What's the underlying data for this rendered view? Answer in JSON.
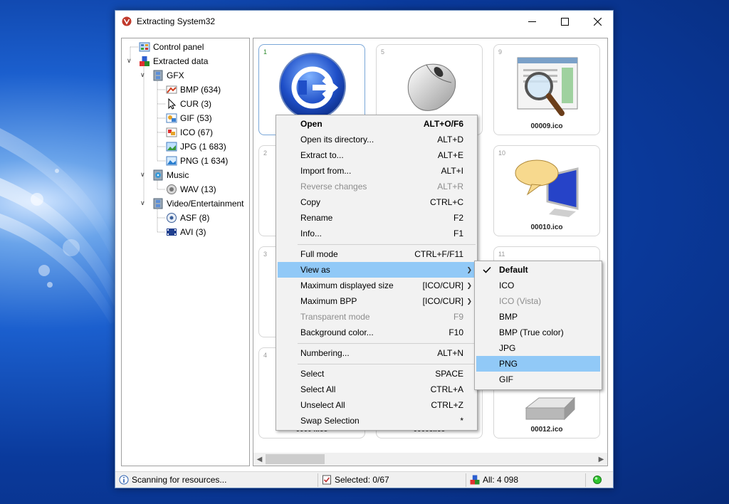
{
  "window": {
    "title": "Extracting System32"
  },
  "tree": [
    {
      "label": "Control panel",
      "icon": "control-panel-icon"
    },
    {
      "label": "Extracted data",
      "icon": "extracted-data-icon"
    },
    {
      "label": "GFX",
      "icon": "film-icon"
    },
    {
      "label": "BMP (634)",
      "icon": "bmp-icon"
    },
    {
      "label": "CUR (3)",
      "icon": "cursor-icon"
    },
    {
      "label": "GIF (53)",
      "icon": "gif-icon"
    },
    {
      "label": "ICO (67)",
      "icon": "ico-icon"
    },
    {
      "label": "JPG (1 683)",
      "icon": "jpg-icon"
    },
    {
      "label": "PNG (1 634)",
      "icon": "png-icon"
    },
    {
      "label": "Music",
      "icon": "music-icon"
    },
    {
      "label": "WAV (13)",
      "icon": "speaker-icon"
    },
    {
      "label": "Video/Entertainment",
      "icon": "film-icon"
    },
    {
      "label": "ASF (8)",
      "icon": "asf-icon"
    },
    {
      "label": "AVI (3)",
      "icon": "avi-icon"
    }
  ],
  "tiles": [
    {
      "num": "1",
      "name": "",
      "icon": "start-orb-icon"
    },
    {
      "num": "5",
      "name": "",
      "icon": "mouse-icon"
    },
    {
      "num": "9",
      "name": "00009.ico",
      "icon": "magnifier-document-icon"
    },
    {
      "num": "2",
      "name": "",
      "icon": ""
    },
    {
      "num": "10",
      "name": "00010.ico",
      "icon": "monitor-speech-icon"
    },
    {
      "num": "3",
      "name": "",
      "icon": ""
    },
    {
      "num": "11",
      "name": "",
      "icon": ""
    },
    {
      "num": "4",
      "name": "00004.ico",
      "icon": ""
    },
    {
      "num": "",
      "name": "00008.ico",
      "icon": ""
    },
    {
      "num": "",
      "name": "00012.ico",
      "icon": "keyboard-keys-icon"
    }
  ],
  "context_menu": [
    {
      "label": "Open",
      "shortcut": "ALT+O/F6",
      "bold": true
    },
    {
      "label": "Open its directory...",
      "shortcut": "ALT+D"
    },
    {
      "label": "Extract to...",
      "shortcut": "ALT+E"
    },
    {
      "label": "Import from...",
      "shortcut": "ALT+I"
    },
    {
      "label": "Reverse changes",
      "shortcut": "ALT+R",
      "disabled": true
    },
    {
      "label": "Copy",
      "shortcut": "CTRL+C"
    },
    {
      "label": "Rename",
      "shortcut": "F2"
    },
    {
      "label": "Info...",
      "shortcut": "F1"
    },
    {
      "label": "Full mode",
      "shortcut": "CTRL+F/F11"
    },
    {
      "label": "View as",
      "shortcut": "",
      "submenu": true,
      "highlighted": true
    },
    {
      "label": "Maximum displayed size",
      "shortcut": "[ICO/CUR]",
      "submenu": true
    },
    {
      "label": "Maximum BPP",
      "shortcut": "[ICO/CUR]",
      "submenu": true
    },
    {
      "label": "Transparent mode",
      "shortcut": "F9",
      "disabled": true
    },
    {
      "label": "Background color...",
      "shortcut": "F10"
    },
    {
      "label": "Numbering...",
      "shortcut": "ALT+N"
    },
    {
      "label": "Select",
      "shortcut": "SPACE"
    },
    {
      "label": "Select All",
      "shortcut": "CTRL+A"
    },
    {
      "label": "Unselect All",
      "shortcut": "CTRL+Z"
    },
    {
      "label": "Swap Selection",
      "shortcut": "*"
    }
  ],
  "submenu": [
    {
      "label": "Default",
      "checked": true,
      "bold": true
    },
    {
      "label": "ICO"
    },
    {
      "label": "ICO (Vista)",
      "disabled": true
    },
    {
      "label": "BMP"
    },
    {
      "label": "BMP (True color)"
    },
    {
      "label": "JPG"
    },
    {
      "label": "PNG",
      "highlighted": true
    },
    {
      "label": "GIF"
    }
  ],
  "status": {
    "scanning": "Scanning for resources...",
    "selected": "Selected: 0/67",
    "all": "All: 4 098"
  },
  "colors": {
    "highlight": "#91c9f7",
    "status_led": "#2fc42f"
  }
}
